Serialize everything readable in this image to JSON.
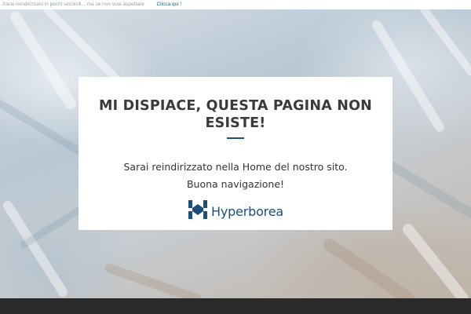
{
  "topbar": {
    "notice": "Sarai reindirizzato in pochi secondi... ma se non vuoi aspettare",
    "link_label": "Clicca qui !"
  },
  "card": {
    "title": "MI DISPIACE, QUESTA PAGINA NON ESISTE!",
    "message_1": "Sarai reindirizzato nella Home del nostro sito.",
    "message_2": "Buona navigazione!",
    "logo_text": "Hyperborea",
    "logo_icon": "hyperborea-logo-icon"
  },
  "colors": {
    "brand": "#1f4e79",
    "link": "#1f5f8b",
    "title_text": "#3a3a3a",
    "footer": "#2a2a2a"
  }
}
